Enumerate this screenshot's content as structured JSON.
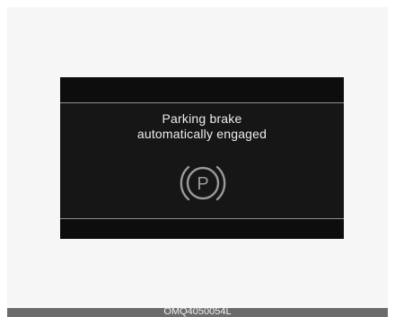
{
  "message": {
    "line1": "Parking brake",
    "line2": "automatically engaged"
  },
  "icon": {
    "name": "parking-brake-icon",
    "glyph": "P"
  },
  "caption": "OMQ4050054L",
  "colors": {
    "screen": "#161616",
    "screen_band": "#0d0d0d",
    "separator": "#8f8f8f",
    "text": "#ececec",
    "icon": "#9a9a9a",
    "caption_bar": "#6b6b6b"
  }
}
